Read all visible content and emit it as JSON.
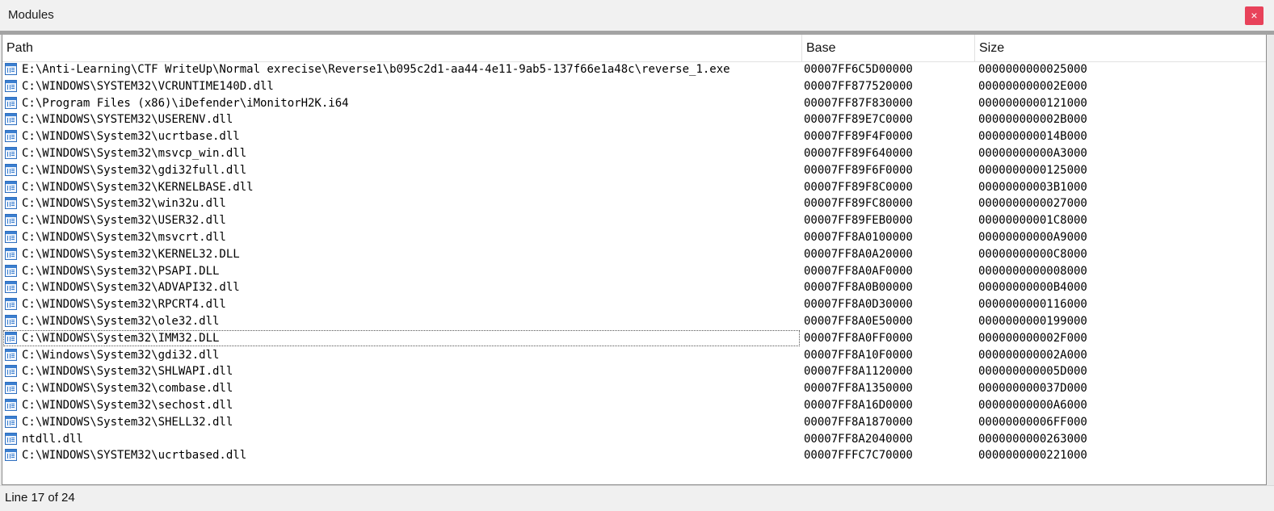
{
  "window": {
    "title": "Modules",
    "close_label": "×"
  },
  "columns": {
    "path": "Path",
    "base": "Base",
    "size": "Size"
  },
  "rows": [
    {
      "path": "E:\\Anti-Learning\\CTF WriteUp\\Normal exrecise\\Reverse1\\b095c2d1-aa44-4e11-9ab5-137f66e1a48c\\reverse_1.exe",
      "base": "00007FF6C5D00000",
      "size": "0000000000025000"
    },
    {
      "path": "C:\\WINDOWS\\SYSTEM32\\VCRUNTIME140D.dll",
      "base": "00007FF877520000",
      "size": "000000000002E000"
    },
    {
      "path": "C:\\Program Files (x86)\\iDefender\\iMonitorH2K.i64",
      "base": "00007FF87F830000",
      "size": "0000000000121000"
    },
    {
      "path": "C:\\WINDOWS\\SYSTEM32\\USERENV.dll",
      "base": "00007FF89E7C0000",
      "size": "000000000002B000"
    },
    {
      "path": "C:\\WINDOWS\\System32\\ucrtbase.dll",
      "base": "00007FF89F4F0000",
      "size": "000000000014B000"
    },
    {
      "path": "C:\\WINDOWS\\System32\\msvcp_win.dll",
      "base": "00007FF89F640000",
      "size": "00000000000A3000"
    },
    {
      "path": "C:\\WINDOWS\\System32\\gdi32full.dll",
      "base": "00007FF89F6F0000",
      "size": "0000000000125000"
    },
    {
      "path": "C:\\WINDOWS\\System32\\KERNELBASE.dll",
      "base": "00007FF89F8C0000",
      "size": "00000000003B1000"
    },
    {
      "path": "C:\\WINDOWS\\System32\\win32u.dll",
      "base": "00007FF89FC80000",
      "size": "0000000000027000"
    },
    {
      "path": "C:\\WINDOWS\\System32\\USER32.dll",
      "base": "00007FF89FEB0000",
      "size": "00000000001C8000"
    },
    {
      "path": "C:\\WINDOWS\\System32\\msvcrt.dll",
      "base": "00007FF8A0100000",
      "size": "00000000000A9000"
    },
    {
      "path": "C:\\WINDOWS\\System32\\KERNEL32.DLL",
      "base": "00007FF8A0A20000",
      "size": "00000000000C8000"
    },
    {
      "path": "C:\\WINDOWS\\System32\\PSAPI.DLL",
      "base": "00007FF8A0AF0000",
      "size": "0000000000008000"
    },
    {
      "path": "C:\\WINDOWS\\System32\\ADVAPI32.dll",
      "base": "00007FF8A0B00000",
      "size": "00000000000B4000"
    },
    {
      "path": "C:\\WINDOWS\\System32\\RPCRT4.dll",
      "base": "00007FF8A0D30000",
      "size": "0000000000116000"
    },
    {
      "path": "C:\\WINDOWS\\System32\\ole32.dll",
      "base": "00007FF8A0E50000",
      "size": "0000000000199000"
    },
    {
      "path": "C:\\WINDOWS\\System32\\IMM32.DLL",
      "base": "00007FF8A0FF0000",
      "size": "000000000002F000"
    },
    {
      "path": "C:\\Windows\\System32\\gdi32.dll",
      "base": "00007FF8A10F0000",
      "size": "000000000002A000"
    },
    {
      "path": "C:\\WINDOWS\\System32\\SHLWAPI.dll",
      "base": "00007FF8A1120000",
      "size": "000000000005D000"
    },
    {
      "path": "C:\\WINDOWS\\System32\\combase.dll",
      "base": "00007FF8A1350000",
      "size": "000000000037D000"
    },
    {
      "path": "C:\\WINDOWS\\System32\\sechost.dll",
      "base": "00007FF8A16D0000",
      "size": "00000000000A6000"
    },
    {
      "path": "C:\\WINDOWS\\System32\\SHELL32.dll",
      "base": "00007FF8A1870000",
      "size": "00000000006FF000"
    },
    {
      "path": "ntdll.dll",
      "base": "00007FF8A2040000",
      "size": "0000000000263000"
    },
    {
      "path": "C:\\WINDOWS\\SYSTEM32\\ucrtbased.dll",
      "base": "00007FFFC7C70000",
      "size": "0000000000221000"
    }
  ],
  "selected_row": 16,
  "status": {
    "text": "Line 17 of 24"
  },
  "colors": {
    "close_button": "#e8425a",
    "module_icon": "#2f6fbf"
  }
}
